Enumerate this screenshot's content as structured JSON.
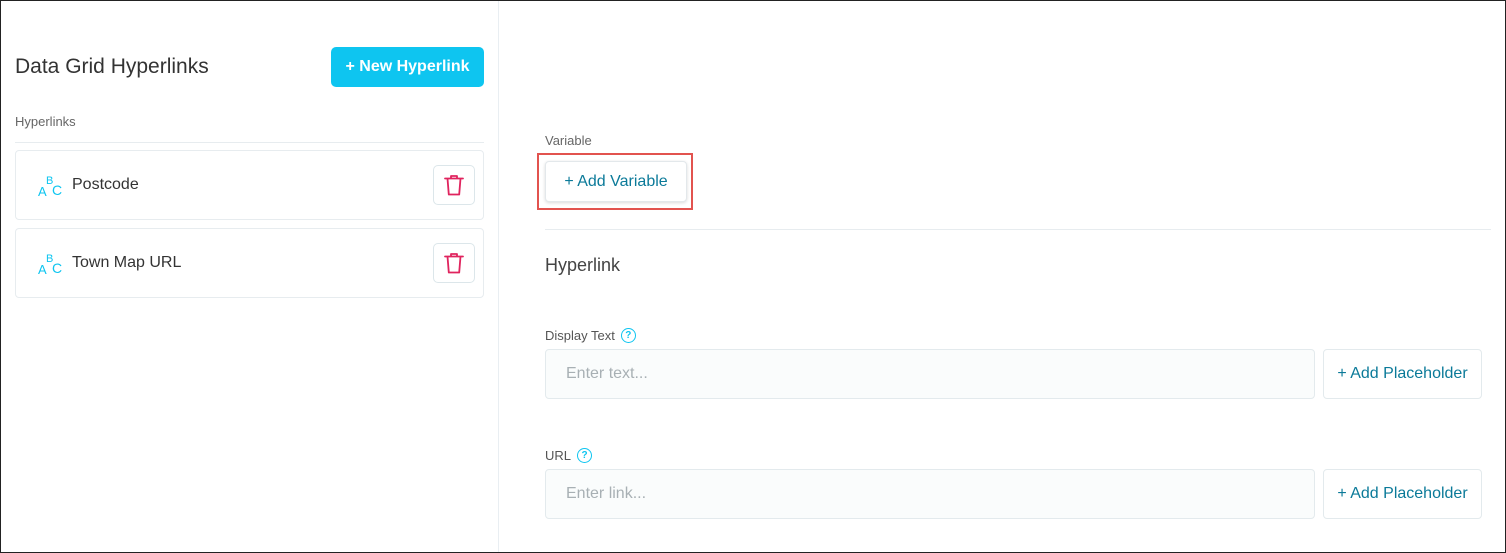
{
  "sidebar": {
    "title": "Data Grid Hyperlinks",
    "new_button": "+ New Hyperlink",
    "section_label": "Hyperlinks",
    "items": [
      {
        "label": "Postcode",
        "icon": "abc-text-icon"
      },
      {
        "label": "Town Map URL",
        "icon": "abc-text-icon"
      }
    ]
  },
  "editor": {
    "variable_label": "Variable",
    "add_variable_button": "+ Add Variable",
    "hyperlink_heading": "Hyperlink",
    "display_text": {
      "label": "Display Text",
      "placeholder": "Enter text...",
      "value": "",
      "add_placeholder_button": "+ Add Placeholder"
    },
    "url": {
      "label": "URL",
      "placeholder": "Enter link...",
      "value": "",
      "add_placeholder_button": "+ Add Placeholder"
    }
  },
  "colors": {
    "accent": "#0ec5f0",
    "link_text": "#0b7a99",
    "delete": "#e0245e",
    "highlight": "#e2534f"
  }
}
